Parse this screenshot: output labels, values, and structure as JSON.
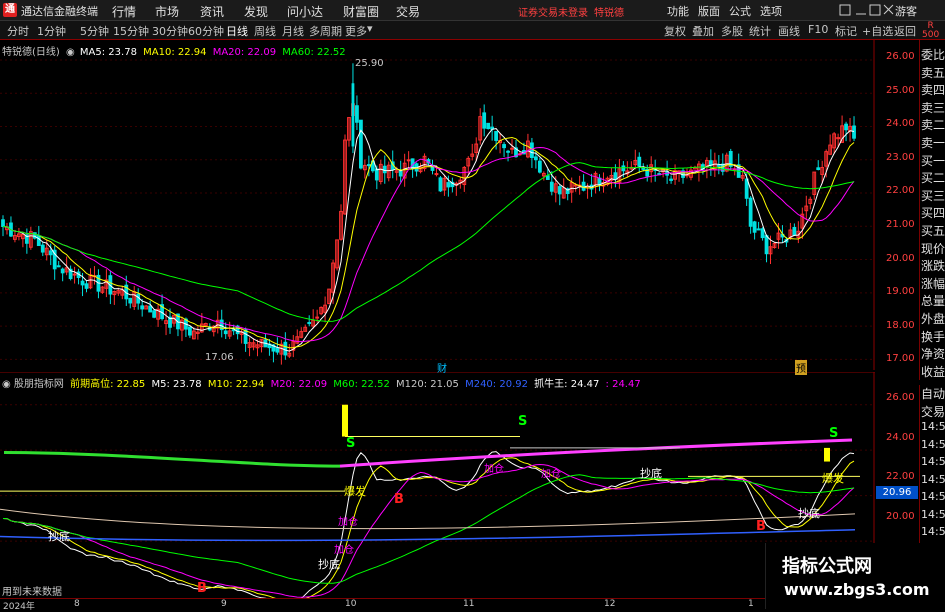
{
  "app": {
    "title": "通达信金融终端",
    "menus": [
      "行情",
      "市场",
      "资讯",
      "发现",
      "问小达",
      "财富圈",
      "交易"
    ],
    "notice": "证券交易未登录",
    "stock_name": "特锐德",
    "right_menus": [
      "功能",
      "版面",
      "公式",
      "选项"
    ],
    "guest": "游客",
    "badge_r": "R",
    "badge_500": "500"
  },
  "toolbar": {
    "periods": [
      "分时",
      "1分钟",
      "5分钟",
      "15分钟",
      "30分钟",
      "60分钟",
      "日线",
      "周线",
      "月线",
      "多周期",
      "更多"
    ],
    "active": "日线",
    "right": [
      "复权",
      "叠加",
      "多股",
      "统计",
      "画线",
      "F10",
      "标记",
      "+自选",
      "返回"
    ]
  },
  "main": {
    "legend_title": "特锐德(日线)",
    "ma5": "MA5: 23.78",
    "ma10": "MA10: 22.94",
    "ma20": "MA20: 22.09",
    "ma60": "MA60: 22.52",
    "high_label": "25.90",
    "low_label": "17.06",
    "marker_cai": "财",
    "marker_yu": "预",
    "colors": {
      "ma5": "#ffffff",
      "ma10": "#ffff00",
      "ma20": "#ff00ff",
      "ma60": "#00ff00",
      "up": "#ff3030",
      "down": "#00e0e0"
    },
    "yticks": [
      "26.00",
      "25.00",
      "24.00",
      "23.00",
      "22.00",
      "21.00",
      "20.00",
      "19.00",
      "18.00",
      "17.00"
    ]
  },
  "indicator": {
    "name": "股朋指标网",
    "qianqi": "前期高位: 22.85",
    "m5": "M5: 23.78",
    "m10": "M10: 22.94",
    "m20": "M20: 22.09",
    "m60": "M60: 22.52",
    "m120": "M120: 21.05",
    "m240": "M240: 20.92",
    "zhuaniu": "抓牛王: 24.47",
    "zhuaniu2": ": 24.47",
    "yticks": [
      "26.00",
      "24.00",
      "22.00",
      "20.00"
    ],
    "price_badge": "20.96",
    "labels": {
      "chaodi1": "抄底",
      "chaodi2": "抄底",
      "chaodi3": "抄底",
      "chaodi4": "抄底",
      "baofa1": "爆发",
      "baofa2": "爆发",
      "jiacang1": "加仓",
      "jiacang2": "加仓",
      "jiacang3": "加仓",
      "jiacang4": "加仓",
      "s1": "S",
      "s2": "S",
      "s3": "S",
      "b1": "B",
      "b2": "B",
      "b3": "B"
    }
  },
  "order_panel": [
    "委比",
    "卖五",
    "卖四",
    "卖三",
    "卖二",
    "卖一",
    "买一",
    "买二",
    "买三",
    "买四",
    "买五",
    "现价",
    "涨跌",
    "涨幅",
    "总量",
    "外盘",
    "换手",
    "净资",
    "收益"
  ],
  "time_panel": [
    "自动",
    "交易",
    "14:56",
    "14:56",
    "14:56",
    "14:56",
    "14:56",
    "14:56",
    "14:56",
    "14:56",
    "14:56"
  ],
  "dates": [
    "2024年",
    "8",
    "9",
    "10",
    "11",
    "12",
    "1"
  ],
  "bottom_left": "用到未来数据",
  "watermark": {
    "line1": "指标公式网",
    "line2": "www.zbgs3.com"
  }
}
